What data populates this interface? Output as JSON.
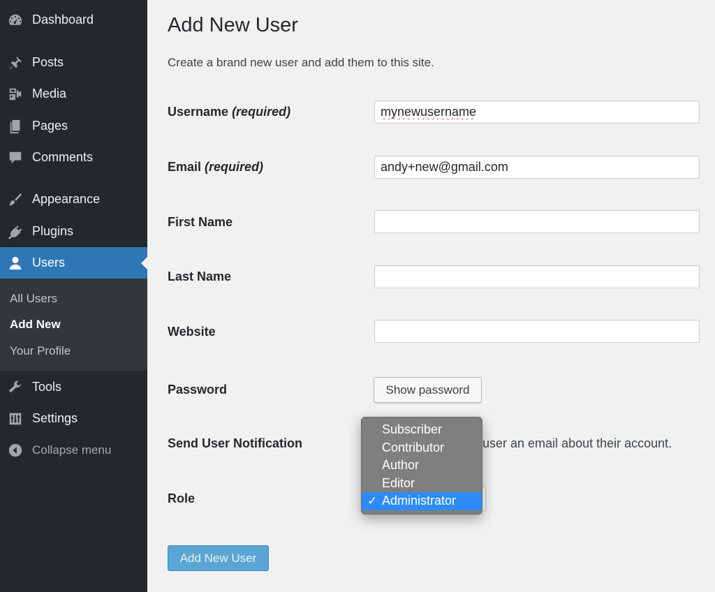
{
  "sidebar": {
    "items": [
      {
        "label": "Dashboard",
        "icon": "dashboard-icon"
      },
      {
        "label": "Posts",
        "icon": "pin-icon"
      },
      {
        "label": "Media",
        "icon": "media-icon"
      },
      {
        "label": "Pages",
        "icon": "pages-icon"
      },
      {
        "label": "Comments",
        "icon": "comment-icon"
      },
      {
        "label": "Appearance",
        "icon": "brush-icon"
      },
      {
        "label": "Plugins",
        "icon": "plug-icon"
      },
      {
        "label": "Users",
        "icon": "user-icon"
      },
      {
        "label": "Tools",
        "icon": "wrench-icon"
      },
      {
        "label": "Settings",
        "icon": "sliders-icon"
      }
    ],
    "submenu": [
      {
        "label": "All Users"
      },
      {
        "label": "Add New"
      },
      {
        "label": "Your Profile"
      }
    ],
    "collapse_label": "Collapse menu"
  },
  "page": {
    "title": "Add New User",
    "description": "Create a brand new user and add them to this site."
  },
  "form": {
    "username": {
      "label": "Username",
      "required": "(required)",
      "value": "mynewusername"
    },
    "email": {
      "label": "Email",
      "required": "(required)",
      "value": "andy+new@gmail.com"
    },
    "first_name": {
      "label": "First Name",
      "value": ""
    },
    "last_name": {
      "label": "Last Name",
      "value": ""
    },
    "website": {
      "label": "Website",
      "value": ""
    },
    "password": {
      "label": "Password",
      "button_label": "Show password"
    },
    "notification": {
      "label": "Send User Notification",
      "text_visible": "user an email about their account."
    },
    "role": {
      "label": "Role",
      "options": [
        "Subscriber",
        "Contributor",
        "Author",
        "Editor",
        "Administrator"
      ],
      "selected": "Administrator",
      "check_glyph": "✓"
    },
    "submit_label": "Add New User"
  },
  "colors": {
    "sidebar_bg": "#23282d",
    "submenu_bg": "#32373c",
    "accent": "#2e77b4",
    "dropdown_bg": "#7f7f7f",
    "dropdown_selected": "#2e8bf5",
    "primary_button": "#5aa5d3"
  }
}
